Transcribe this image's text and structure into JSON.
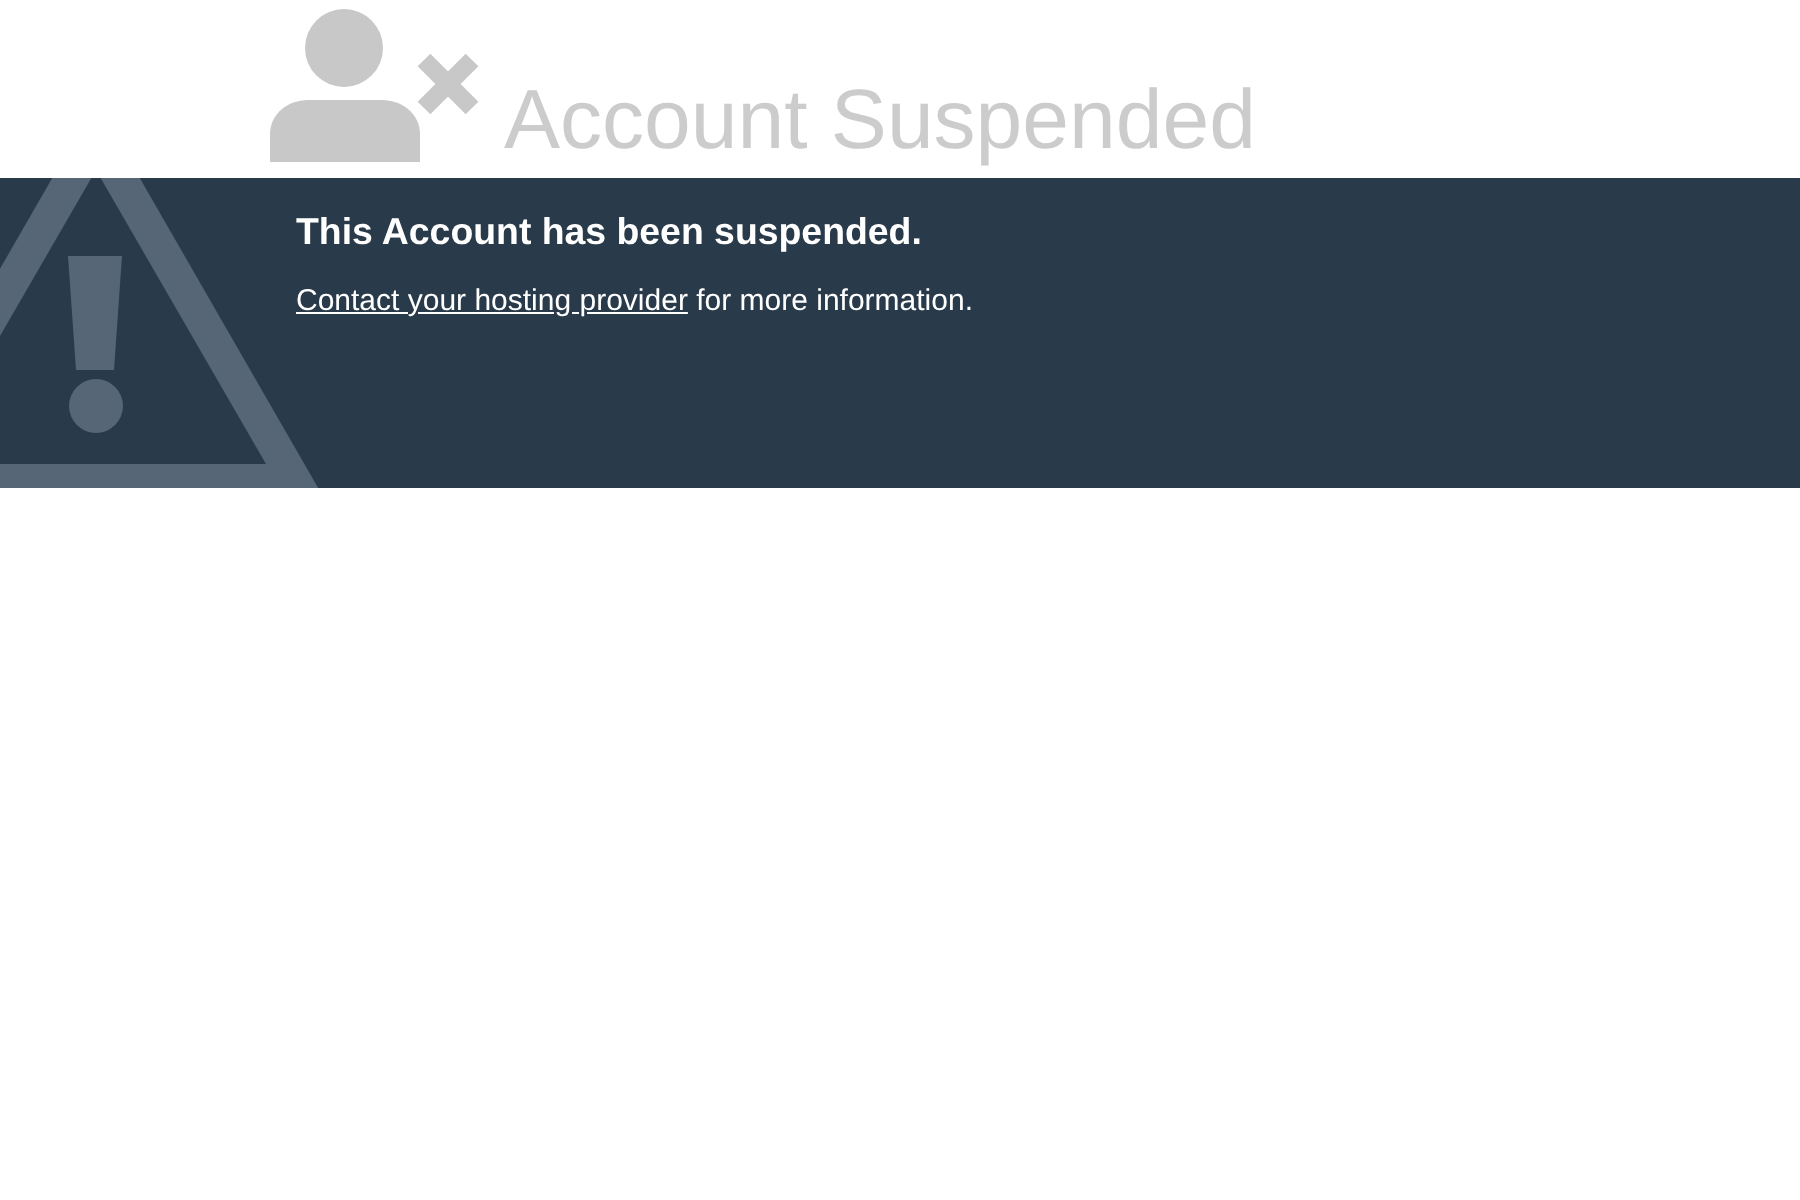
{
  "header": {
    "title": "Account Suspended"
  },
  "notice": {
    "heading": "This Account has been suspended.",
    "message": {
      "link": "Contact your hosting provider",
      "text": "for more information."
    }
  }
}
